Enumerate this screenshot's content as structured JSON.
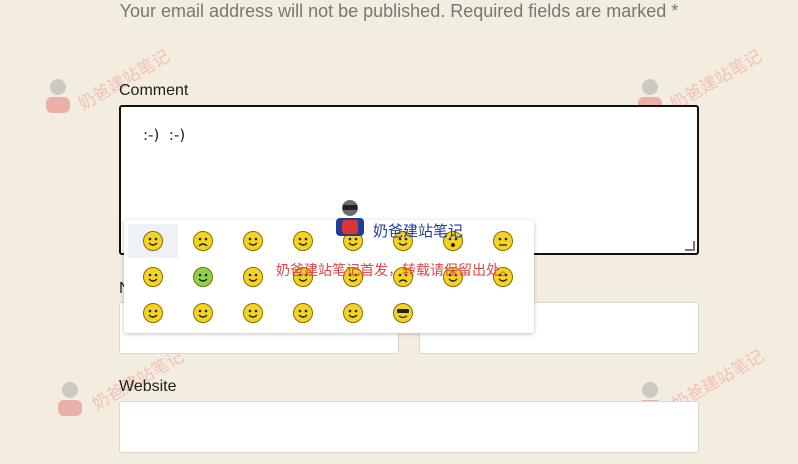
{
  "form": {
    "notice": "Your email address will not be published. Required fields are marked *",
    "comment_label": "Comment",
    "comment_value": ":-)  :-)",
    "name_label_partial": "N",
    "website_label": "Website"
  },
  "smilies": {
    "items": [
      {
        "icon": "smile-icon",
        "hover": true
      },
      {
        "icon": "frown-icon"
      },
      {
        "icon": "grin-icon"
      },
      {
        "icon": "tongue-icon"
      },
      {
        "icon": "laugh-icon"
      },
      {
        "icon": "wink-icon"
      },
      {
        "icon": "surprised-icon"
      },
      {
        "icon": "neutral-icon"
      },
      {
        "icon": "sleepy-icon"
      },
      {
        "icon": "sick-icon"
      },
      {
        "icon": "wave-icon"
      },
      {
        "icon": "blush-icon"
      },
      {
        "icon": "confused-icon"
      },
      {
        "icon": "cry-icon"
      },
      {
        "icon": "smirk-icon"
      },
      {
        "icon": "shy-icon"
      },
      {
        "icon": "think-icon"
      },
      {
        "icon": "hammer-icon"
      },
      {
        "icon": "salute-icon"
      },
      {
        "icon": "crazy-icon"
      },
      {
        "icon": "happy-icon"
      },
      {
        "icon": "cool-icon"
      }
    ]
  },
  "overlay": {
    "title": "奶爸建站笔记",
    "note": "奶爸建站笔记首发，转载请保留出处。"
  },
  "watermark": {
    "text": "奶爸建站笔记"
  }
}
